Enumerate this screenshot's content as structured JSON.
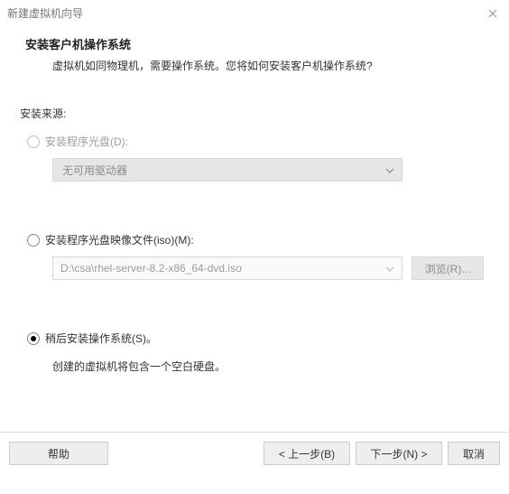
{
  "window": {
    "title": "新建虚拟机向导"
  },
  "header": {
    "title": "安装客户机操作系统",
    "subtitle": "虚拟机如同物理机，需要操作系统。您将如何安装客户机操作系统?"
  },
  "source": {
    "label": "安装来源:"
  },
  "optionDisc": {
    "label": "安装程序光盘(D):",
    "dropdown": "无可用驱动器"
  },
  "optionIso": {
    "label": "安装程序光盘映像文件(iso)(M):",
    "path": "D:\\csa\\rhel-server-8.2-x86_64-dvd.iso",
    "browse": "浏览(R)..."
  },
  "optionLater": {
    "label": "稍后安装操作系统(S)。",
    "note": "创建的虚拟机将包含一个空白硬盘。"
  },
  "footer": {
    "help": "帮助",
    "back": "< 上一步(B)",
    "next": "下一步(N) >",
    "cancel": "取消"
  }
}
